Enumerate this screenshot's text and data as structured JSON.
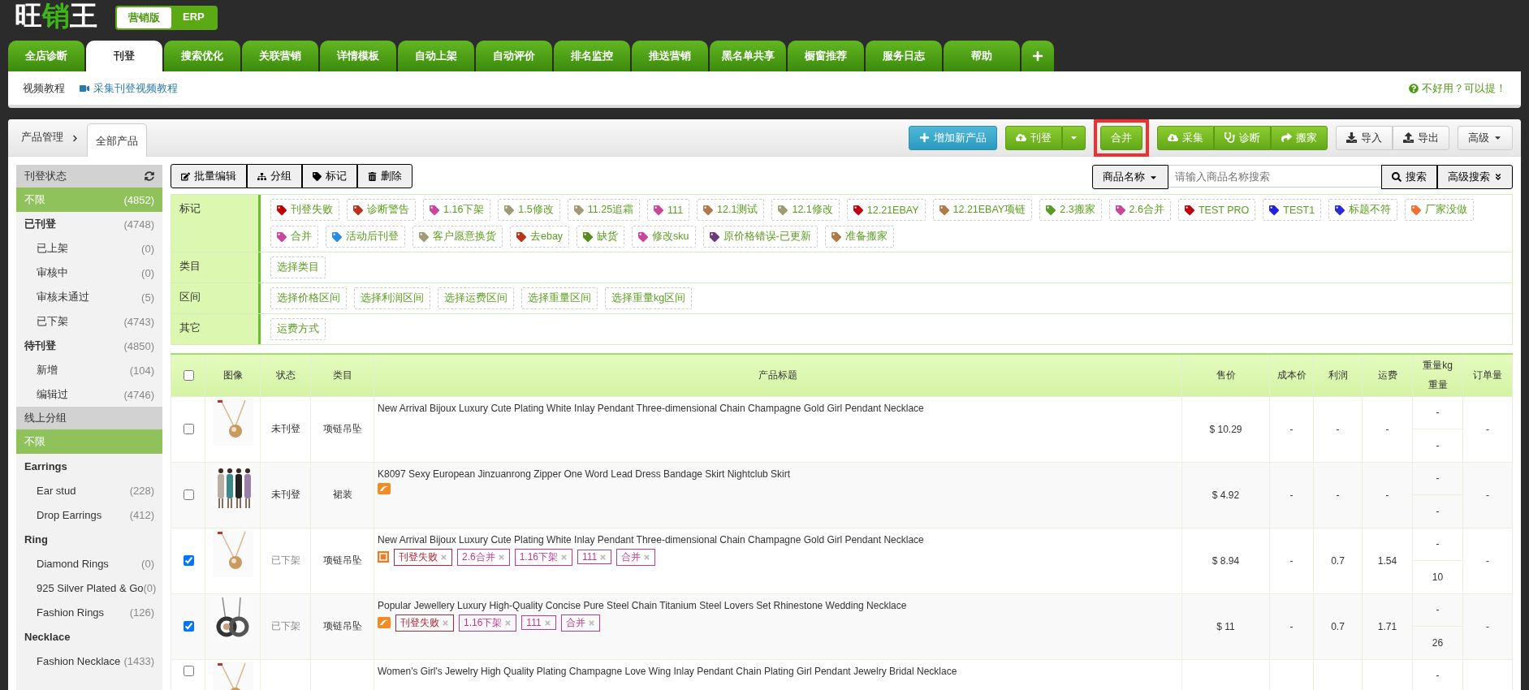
{
  "logo": {
    "parts": [
      {
        "text": "旺",
        "accent": false
      },
      {
        "text": "销",
        "accent": true
      },
      {
        "text": "王",
        "accent": false
      }
    ]
  },
  "editions": [
    {
      "label": "营销版",
      "selected": true
    },
    {
      "label": "ERP",
      "selected": false
    }
  ],
  "nav_tabs": [
    {
      "kind": "text",
      "label": "全店诊断",
      "selected": false
    },
    {
      "kind": "text",
      "label": "刊登",
      "selected": true
    },
    {
      "kind": "text",
      "label": "搜索优化",
      "selected": false
    },
    {
      "kind": "text",
      "label": "关联营销",
      "selected": false
    },
    {
      "kind": "text",
      "label": "详情模板",
      "selected": false
    },
    {
      "kind": "text",
      "label": "自动上架",
      "selected": false
    },
    {
      "kind": "text",
      "label": "自动评价",
      "selected": false
    },
    {
      "kind": "text",
      "label": "排名监控",
      "selected": false
    },
    {
      "kind": "text",
      "label": "推送营销",
      "selected": false
    },
    {
      "kind": "text",
      "label": "黑名单共享",
      "selected": false
    },
    {
      "kind": "text",
      "label": "橱窗推荐",
      "selected": false
    },
    {
      "kind": "text",
      "label": "服务日志",
      "selected": false
    },
    {
      "kind": "text",
      "label": "帮助",
      "selected": false
    },
    {
      "kind": "add",
      "selected": false
    }
  ],
  "sub_bar": {
    "label": "视频教程",
    "link": "采集刊登视频教程",
    "feedback": "不好用？可以提！"
  },
  "breadcrumb": {
    "root": "产品管理",
    "tab": "全部产品"
  },
  "action_groups": [
    {
      "kind": "primary",
      "buttons": [
        {
          "label": "增加新产品",
          "highlighted": false
        }
      ]
    },
    {
      "kind": "success",
      "dropdown": true,
      "buttons": [
        {
          "label": "刊登",
          "highlighted": false
        }
      ]
    },
    {
      "kind": "success",
      "buttons": [
        {
          "label": "合并",
          "highlighted": true
        }
      ]
    },
    {
      "kind": "success",
      "buttons": [
        {
          "label": "采集",
          "highlighted": false
        },
        {
          "label": "诊断",
          "highlighted": false
        },
        {
          "label": "搬家",
          "highlighted": false
        }
      ]
    },
    {
      "kind": "default",
      "buttons": [
        {
          "label": "导入",
          "highlighted": false
        },
        {
          "label": "导出",
          "highlighted": false
        }
      ]
    },
    {
      "kind": "default",
      "dropdown": true,
      "buttons": [
        {
          "label": "高级",
          "highlighted": false
        }
      ]
    }
  ],
  "sidebar": {
    "sections": [
      {
        "title": "刊登状态",
        "items": [
          {
            "label": "不限",
            "count": "(4852)",
            "selected": true
          },
          {
            "label": "已刊登",
            "count": "(4748)",
            "selected": false,
            "children": [
              {
                "label": "已上架",
                "count": "(0)",
                "selected": false
              },
              {
                "label": "审核中",
                "count": "(0)",
                "selected": false
              },
              {
                "label": "审核未通过",
                "count": "(5)",
                "selected": false
              },
              {
                "label": "已下架",
                "count": "(4743)",
                "selected": false
              }
            ]
          },
          {
            "label": "待刊登",
            "count": "(4850)",
            "selected": false,
            "children": [
              {
                "label": "新增",
                "count": "(104)",
                "selected": false
              },
              {
                "label": "编辑过",
                "count": "(4746)",
                "selected": false
              }
            ]
          }
        ]
      },
      {
        "title": "线上分组",
        "items": [
          {
            "label": "不限",
            "selected": true
          },
          {
            "label": "Earrings",
            "selected": false,
            "children": [
              {
                "label": "Ear stud",
                "count": "(228)",
                "selected": false
              },
              {
                "label": "Drop Earrings",
                "count": "(412)",
                "selected": false
              }
            ]
          },
          {
            "label": "Ring",
            "selected": false,
            "children": [
              {
                "label": "Diamond Rings",
                "count": "(0)",
                "selected": false
              },
              {
                "label": "925 Silver Plated & Go",
                "count": "(0)",
                "selected": false
              },
              {
                "label": "Fashion Rings",
                "count": "(126)",
                "selected": false
              }
            ]
          },
          {
            "label": "Necklace",
            "selected": false,
            "children": [
              {
                "label": "Fashion Necklace",
                "count": "(1433)",
                "selected": false
              }
            ]
          }
        ]
      }
    ]
  },
  "toolbar": [
    "批量编辑",
    "分组",
    "标记",
    "删除"
  ],
  "search": {
    "field": "商品名称",
    "placeholder": "请输入商品名称搜索",
    "button": "搜索",
    "advanced": "高级搜索"
  },
  "filters": [
    {
      "label": "标记",
      "kind": "tags",
      "tags": [
        {
          "label": "刊登失败",
          "color": "#c00000"
        },
        {
          "label": "诊断警告",
          "color": "#b8341c"
        },
        {
          "label": "1.16下架",
          "color": "#c9479b"
        },
        {
          "label": "1.5修改",
          "color": "#a09a76"
        },
        {
          "label": "11.25追霜",
          "color": "#a09a76"
        },
        {
          "label": "111",
          "color": "#c9479b"
        },
        {
          "label": "12.1测试",
          "color": "#b07a48"
        },
        {
          "label": "12.1修改",
          "color": "#a09a76"
        },
        {
          "label": "12.21EBAY",
          "color": "#c00010"
        },
        {
          "label": "12.21EBAY项链",
          "color": "#b07a48"
        },
        {
          "label": "2.3搬家",
          "color": "#5a9a2a"
        },
        {
          "label": "2.6合并",
          "color": "#c9479b"
        },
        {
          "label": "TEST PRO",
          "color": "#c00010"
        },
        {
          "label": "TEST1",
          "color": "#2020e0"
        },
        {
          "label": "标题不符",
          "color": "#2a2ae0"
        },
        {
          "label": "厂家没做",
          "color": "#f07030"
        },
        {
          "label": "合并",
          "color": "#c9479b"
        },
        {
          "label": "活动后刊登",
          "color": "#2a8ae8"
        },
        {
          "label": "客户愿意换货",
          "color": "#a09a76"
        },
        {
          "label": "去ebay",
          "color": "#b8341c"
        },
        {
          "label": "缺货",
          "color": "#5a8a20"
        },
        {
          "label": "修改sku",
          "color": "#c9479b"
        },
        {
          "label": "原价格错误-已更新",
          "color": "#6a3a7a"
        },
        {
          "label": "准备搬家",
          "color": "#b07a48"
        }
      ]
    },
    {
      "label": "类目",
      "kind": "options",
      "options": [
        "选择类目"
      ]
    },
    {
      "label": "区间",
      "kind": "options",
      "options": [
        "选择价格区间",
        "选择利润区间",
        "选择运费区间",
        "选择重量区间",
        "选择重量kg区间"
      ]
    },
    {
      "label": "其它",
      "kind": "options",
      "options": [
        "运费方式"
      ]
    }
  ],
  "table": {
    "select_all": {
      "checked": false
    },
    "columns": [
      {
        "label": "图像"
      },
      {
        "label": "状态"
      },
      {
        "label": "类目"
      },
      {
        "label": "产品标题"
      },
      {
        "label": "售价"
      },
      {
        "label": "成本价"
      },
      {
        "label": "利润"
      },
      {
        "label": "运费"
      },
      {
        "label": "重量kg",
        "sub": "重量"
      },
      {
        "label": "订单量"
      }
    ],
    "rows": [
      {
        "checked": false,
        "status": "未刊登",
        "muted": false,
        "category": "项链吊坠",
        "title": "New Arrival Bijoux Luxury Cute Plating White Inlay Pendant Three-dimensional Chain Champagne Gold Girl Pendant Necklace",
        "price": "$ 10.29",
        "cost": "-",
        "profit": "-",
        "shipping": "-",
        "weight_kg": "-",
        "weight": "-",
        "orders": "-"
      },
      {
        "checked": false,
        "status": "未刊登",
        "muted": false,
        "category": "裙装",
        "title": "K8097 Sexy European Jinzuanrong Zipper One Word Lead Dress Bandage Skirt Nightclub Skirt",
        "kind": "swirl",
        "price": "$ 4.92",
        "cost": "-",
        "profit": "-",
        "shipping": "-",
        "weight_kg": "-",
        "weight": "-",
        "orders": "-"
      },
      {
        "checked": true,
        "status": "已下架",
        "muted": true,
        "category": "项链吊坠",
        "title": "New Arrival Bijoux Luxury Cute Plating White Inlay Pendant Three-dimensional Chain Champagne Gold Girl Pendant Necklace",
        "kind": "square",
        "tags": [
          {
            "label": "刊登失败",
            "color": "#a8283c"
          },
          {
            "label": "2.6合并",
            "color": "#c0398c"
          },
          {
            "label": "1.16下架",
            "color": "#c0398c"
          },
          {
            "label": "111",
            "color": "#c0398c"
          },
          {
            "label": "合并",
            "color": "#c0398c"
          }
        ],
        "price": "$ 8.94",
        "cost": "-",
        "profit": "0.7",
        "shipping": "1.54",
        "weight_kg": "-",
        "weight": "10",
        "orders": "-"
      },
      {
        "checked": true,
        "status": "已下架",
        "muted": true,
        "category": "项链吊坠",
        "title": "Popular Jewellery Luxury High-Quality Concise Pure Steel Chain Titanium Steel Lovers Set Rhinestone Wedding Necklace",
        "kind": "swirl",
        "tags": [
          {
            "label": "刊登失败",
            "color": "#a8283c"
          },
          {
            "label": "1.16下架",
            "color": "#c0398c"
          },
          {
            "label": "111",
            "color": "#c0398c"
          },
          {
            "label": "合并",
            "color": "#c0398c"
          }
        ],
        "price": "$ 11",
        "cost": "-",
        "profit": "0.7",
        "shipping": "1.71",
        "weight_kg": "-",
        "weight": "26",
        "orders": "-"
      },
      {
        "checked": false,
        "title": "Women's Girl's Jewelry High Quality Plating Champagne Love Wing Inlay Pendant Chain Plating Girl Pendant Jewelry Bridal Necklace",
        "weight_kg": "-"
      }
    ]
  }
}
